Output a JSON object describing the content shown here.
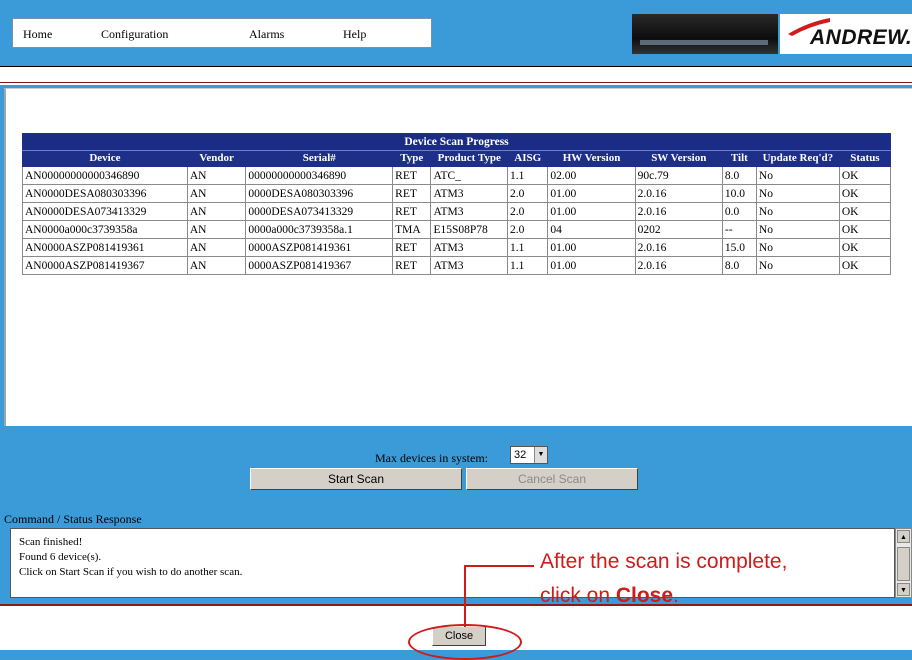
{
  "nav": {
    "items": [
      "Home",
      "Configuration",
      "Alarms",
      "Help"
    ],
    "brand": "ANDREW."
  },
  "table": {
    "caption": "Device Scan Progress",
    "headers": [
      "Device",
      "Vendor",
      "Serial#",
      "Type",
      "Product Type",
      "AISG",
      "HW Version",
      "SW Version",
      "Tilt",
      "Update Req'd?",
      "Status"
    ],
    "rows": [
      [
        "AN00000000000346890",
        "AN",
        "00000000000346890",
        "RET",
        "ATC_",
        "1.1",
        "02.00",
        "90c.79",
        "8.0",
        "No",
        "OK"
      ],
      [
        "AN0000DESA080303396",
        "AN",
        "0000DESA080303396",
        "RET",
        "ATM3",
        "2.0",
        "01.00",
        "2.0.16",
        "10.0",
        "No",
        "OK"
      ],
      [
        "AN0000DESA073413329",
        "AN",
        "0000DESA073413329",
        "RET",
        "ATM3",
        "2.0",
        "01.00",
        "2.0.16",
        "0.0",
        "No",
        "OK"
      ],
      [
        "AN0000a000c3739358a",
        "AN",
        "0000a000c3739358a.1",
        "TMA",
        "E15S08P78",
        "2.0",
        "04",
        "0202",
        "--",
        "No",
        "OK"
      ],
      [
        "AN0000ASZP081419361",
        "AN",
        "0000ASZP081419361",
        "RET",
        "ATM3",
        "1.1",
        "01.00",
        "2.0.16",
        "15.0",
        "No",
        "OK"
      ],
      [
        "AN0000ASZP081419367",
        "AN",
        "0000ASZP081419367",
        "RET",
        "ATM3",
        "1.1",
        "01.00",
        "2.0.16",
        "8.0",
        "No",
        "OK"
      ]
    ]
  },
  "controls": {
    "max_devices_label": "Max devices in system:",
    "max_devices_value": "32",
    "start_scan": "Start Scan",
    "cancel_scan": "Cancel Scan",
    "command_status_label": "Command / Status Response",
    "status_lines": [
      "Scan finished!",
      "Found 6 device(s).",
      "Click on Start Scan if you wish to do another scan."
    ],
    "close": "Close"
  },
  "callout": {
    "line1": "After the scan is complete,",
    "line2_prefix": "click on ",
    "line2_bold": "Close",
    "line2_suffix": "."
  },
  "colors": {
    "background": "#3a9bd8",
    "table_header": "#1e2f8a",
    "callout": "#d11a1a"
  }
}
